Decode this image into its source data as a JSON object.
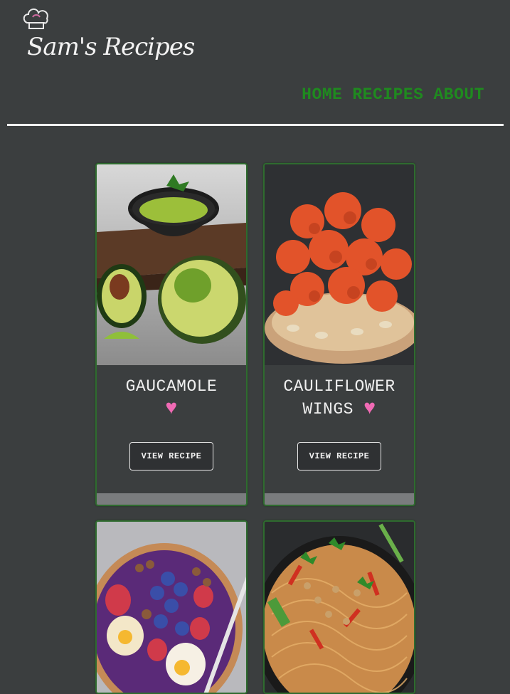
{
  "brand": {
    "logo_text": "Sam's Recipes"
  },
  "nav": {
    "items": [
      "HOME",
      "RECIPES",
      "ABOUT"
    ]
  },
  "cards": [
    {
      "title_line1": "GAUCAMOLE",
      "title_line2": "",
      "heart": "♥",
      "button": "VIEW RECIPE",
      "image": "guacamole-avocado-image"
    },
    {
      "title_line1": "CAULIFLOWER",
      "title_line2": "WINGS",
      "heart": "♥",
      "button": "VIEW RECIPE",
      "image": "cauliflower-wings-image"
    },
    {
      "title_line1": "",
      "title_line2": "",
      "heart": "",
      "button": "",
      "image": "acai-fruit-bowl-image"
    },
    {
      "title_line1": "",
      "title_line2": "",
      "heart": "",
      "button": "",
      "image": "noodle-stir-fry-image"
    }
  ],
  "colors": {
    "background": "#3b3e3f",
    "nav": "#1f8a1f",
    "heart": "#f06ab4",
    "card_border": "#2f6b2f"
  }
}
